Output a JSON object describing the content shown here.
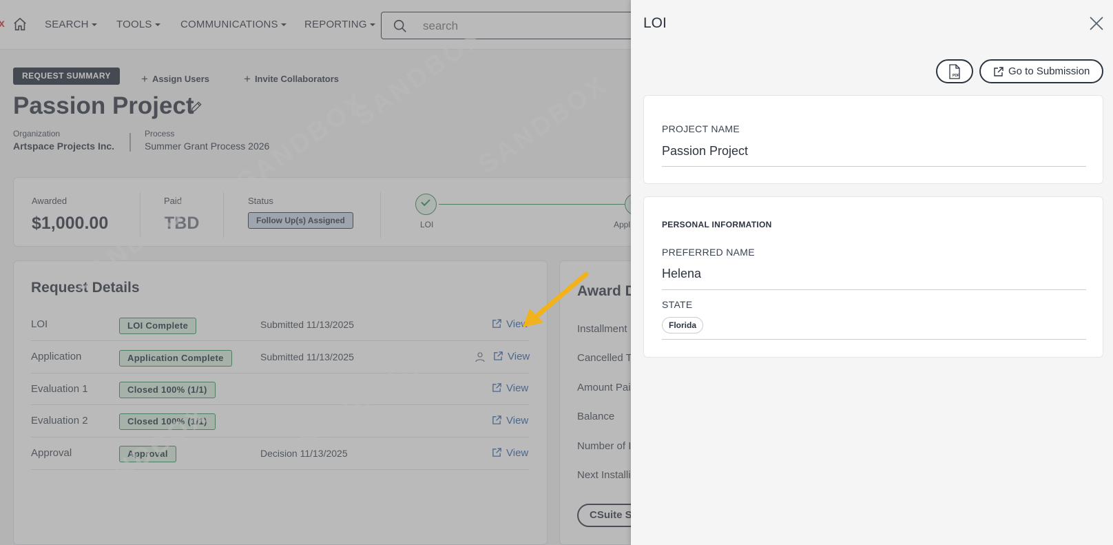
{
  "nav": {
    "brand_fragment": "x",
    "items": [
      {
        "label": "SEARCH"
      },
      {
        "label": "TOOLS"
      },
      {
        "label": "COMMUNICATIONS"
      },
      {
        "label": "REPORTING"
      }
    ],
    "search_placeholder": "search"
  },
  "watermark_text": "SANDBOX",
  "request": {
    "summary_button": "REQUEST SUMMARY",
    "assign_users": "Assign Users",
    "invite_collaborators": "Invite Collaborators",
    "title": "Passion Project",
    "organization_label": "Organization",
    "organization_value": "Artspace Projects Inc.",
    "process_label": "Process",
    "process_value": "Summer Grant Process 2026"
  },
  "stats": {
    "awarded_label": "Awarded",
    "awarded_value": "$1,000.00",
    "paid_label": "Paid",
    "paid_value": "TBD",
    "status_label": "Status",
    "status_value": "Follow Up(s) Assigned",
    "steps": [
      {
        "label": "LOI",
        "complete": true
      },
      {
        "label": "Appl",
        "complete": true
      }
    ]
  },
  "request_details": {
    "title": "Request Details",
    "rows": [
      {
        "label": "LOI",
        "badge": "LOI Complete",
        "date": "Submitted 11/13/2025",
        "view": "View",
        "has_user_icon": false
      },
      {
        "label": "Application",
        "badge": "Application Complete",
        "date": "Submitted 11/13/2025",
        "view": "View",
        "has_user_icon": true
      },
      {
        "label": "Evaluation 1",
        "badge": "Closed 100% (1/1)",
        "date": "",
        "view": "View",
        "has_user_icon": false
      },
      {
        "label": "Evaluation 2",
        "badge": "Closed 100% (1/1)",
        "date": "",
        "view": "View",
        "has_user_icon": false
      },
      {
        "label": "Approval",
        "badge": "Approval",
        "date": "Decision 11/13/2025",
        "view": "View",
        "has_user_icon": false
      }
    ]
  },
  "award_details": {
    "title": "Award D",
    "labels": [
      "Installment",
      "Cancelled T",
      "Amount Pai",
      "Balance",
      "Number of I",
      "Next Installi"
    ],
    "button": "CSuite S"
  },
  "drawer": {
    "title": "LOI",
    "pdf_icon_text": "PDF",
    "goto_button": "Go to Submission",
    "project_card": {
      "label": "PROJECT NAME",
      "value": "Passion Project"
    },
    "personal_card": {
      "section": "PERSONAL INFORMATION",
      "preferred_name_label": "PREFERRED NAME",
      "preferred_name_value": "Helena",
      "state_label": "STATE",
      "state_value": "Florida"
    }
  },
  "colors": {
    "accent_arrow": "#f2b21b",
    "link": "#2e5fa8",
    "success": "#2e8a57",
    "dark": "#1f2a38"
  }
}
